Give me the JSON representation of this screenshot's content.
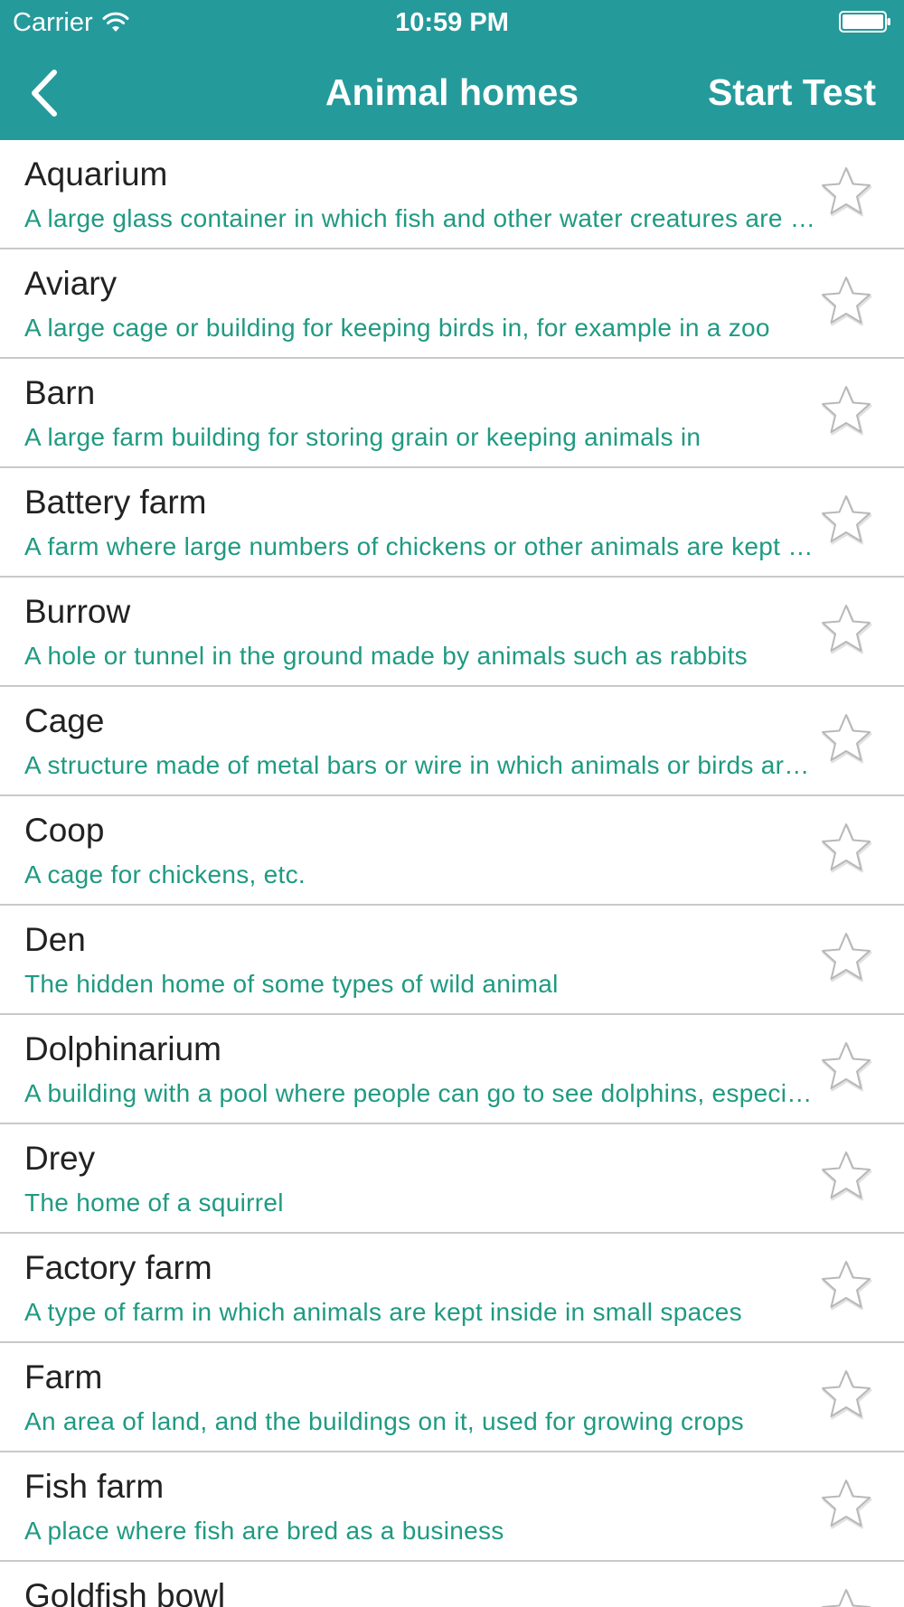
{
  "status_bar": {
    "carrier": "Carrier",
    "time": "10:59 PM"
  },
  "nav": {
    "back_icon": "chevron-left-icon",
    "title": "Animal homes",
    "action_label": "Start Test"
  },
  "colors": {
    "header_bg": "#259a9b",
    "description_text": "#1f9a82",
    "title_text": "#222222",
    "divider": "#c9c9c9"
  },
  "words": [
    {
      "title": "Aquarium",
      "description": "A large glass container in which fish and other water creatures are kept",
      "favorite": false
    },
    {
      "title": "Aviary",
      "description": "A large cage or building for keeping birds in, for example in a zoo",
      "favorite": false
    },
    {
      "title": "Barn",
      "description": "A large farm building for storing grain or keeping animals in",
      "favorite": false
    },
    {
      "title": "Battery farm",
      "description": "A farm where large numbers of chickens or other animals are kept in small cages",
      "favorite": false
    },
    {
      "title": "Burrow",
      "description": "A hole or tunnel in the ground made by animals such as rabbits",
      "favorite": false
    },
    {
      "title": "Cage",
      "description": "A structure made of metal bars or wire in which animals or birds are kept",
      "favorite": false
    },
    {
      "title": "Coop",
      "description": "A cage for chickens, etc.",
      "favorite": false
    },
    {
      "title": "Den",
      "description": "The hidden home of some types of wild animal",
      "favorite": false
    },
    {
      "title": "Dolphinarium",
      "description": "A building with a pool where people can go to see dolphins, especially",
      "favorite": false
    },
    {
      "title": "Drey",
      "description": "The home of a squirrel",
      "favorite": false
    },
    {
      "title": "Factory farm",
      "description": "A type of farm in which animals are kept inside in small spaces",
      "favorite": false
    },
    {
      "title": "Farm",
      "description": "An area of land, and the buildings on it, used for growing crops",
      "favorite": false
    },
    {
      "title": "Fish farm",
      "description": "A place where fish are bred as a business",
      "favorite": false
    },
    {
      "title": "Goldfish bowl",
      "description": "",
      "favorite": false
    }
  ]
}
